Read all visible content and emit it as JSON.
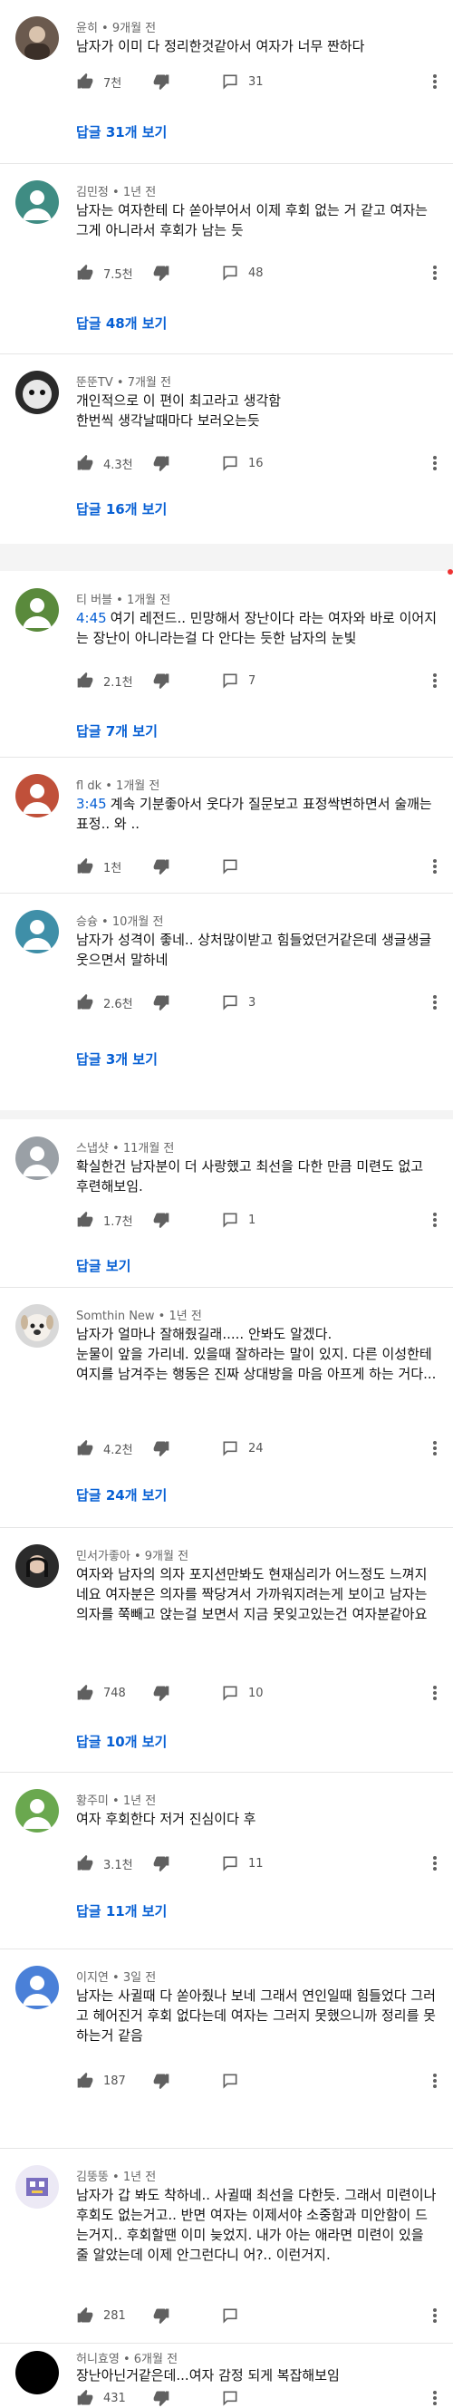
{
  "ui": {
    "accent": "#065fd4",
    "icons": {
      "like": "thumb-up-icon",
      "dislike": "thumb-down-icon",
      "reply": "reply-icon",
      "more": "more-vert-icon"
    }
  },
  "comments": [
    {
      "author": "윤히",
      "time": "9개월 전",
      "text": "남자가 이미 다 정리한것같아서 여자가 너무 짠하다",
      "likes": "7천",
      "reply_count": "31",
      "replies": "답글 31개 보기"
    },
    {
      "author": "김민정",
      "time": "1년 전",
      "text": "남자는 여자한테 다 쏟아부어서 이제 후회 없는 거 같고 여자는 그게 아니라서 후회가 남는 듯",
      "likes": "7.5천",
      "reply_count": "48",
      "replies": "답글 48개 보기"
    },
    {
      "author": "뚠뚠TV",
      "time": "7개월 전",
      "text": "개인적으로 이 편이 최고라고 생각함\n한번씩 생각날때마다 보러오는듯",
      "likes": "4.3천",
      "reply_count": "16",
      "replies": "답글 16개 보기"
    },
    {
      "author": "티 버블",
      "time": "1개월 전",
      "timestamp": "4:45",
      "text": "여기 레전드.. 민망해서 장난이다 라는 여자와  바로 이어지는 장난이 아니라는걸 다 안다는 듯한 남자의 눈빛",
      "likes": "2.1천",
      "reply_count": "7",
      "replies": "답글 7개 보기"
    },
    {
      "author": "fl dk",
      "time": "1개월 전",
      "timestamp": "3:45",
      "text": "계속 기분좋아서 웃다가 질문보고 표정싹변하면서 술깨는 표정.. 와 ..",
      "likes": "1천",
      "reply_count": ""
    },
    {
      "author": "승슝",
      "time": "10개월 전",
      "text": "남자가 성격이 좋네.. 상처많이받고 힘들었던거같은데 생글생글웃으면서 말하네",
      "likes": "2.6천",
      "reply_count": "3",
      "replies": "답글 3개 보기"
    },
    {
      "author": "스냅샷",
      "time": "11개월 전",
      "text": "확실한건 남자분이 더 사랑했고 최선을 다한 만큼 미련도 없고 후련해보임.",
      "likes": "1.7천",
      "reply_count": "1",
      "replies": "답글 보기"
    },
    {
      "author": "Somthin New",
      "time": "1년 전",
      "text": "남자가 얼마나 잘해줬길래..... 안봐도 알겠다.\n눈물이 앞을 가리네. 있을때 잘하라는 말이 있지. 다른 이성한테 여지를 남겨주는 행동은 진짜 상대방을 마음 아프게 하는 거다...",
      "likes": "4.2천",
      "reply_count": "24",
      "replies": "답글 24개 보기"
    },
    {
      "author": "민서가좋아",
      "time": "9개월 전",
      "text": "여자와 남자의 의자 포지션만봐도  현재심리가 어느정도 느껴지네요 여자분은 의자를 짝당겨서 가까워지려는게 보이고 남자는 의자를 쭉빼고 앉는걸 보면서 지금 못잊고있는건 여자분같아요",
      "likes": "748",
      "reply_count": "10",
      "replies": "답글 10개 보기"
    },
    {
      "author": "황주미",
      "time": "1년 전",
      "text": "여자 후회한다 저거 진심이다 후",
      "likes": "3.1천",
      "reply_count": "11",
      "replies": "답글 11개 보기"
    },
    {
      "author": "이지연",
      "time": "3일 전",
      "text": "남자는 사귈때 다 쏟아줬나 보네 그래서 연인일때 힘들었다 그러고 헤어진거 후회 없다는데 여자는 그러지 못했으니까 정리를 못 하는거 같음",
      "likes": "187",
      "reply_count": ""
    },
    {
      "author": "김뚱뚱",
      "time": "1년 전",
      "text": "남자가 갑 봐도 착하네.. 사귈때 최선을 다한듯. 그래서 미련이나 후회도 없는거고.. 반면 여자는 이제서야 소중함과 미안함이 드는거지.. 후회할땐 이미 늦었지. 내가 아는 애라면 미련이 있을 줄 알았는데 이제 안그런다니 어?.. 이런거지.",
      "likes": "281",
      "reply_count": ""
    },
    {
      "author": "허니효영",
      "time": "6개월 전",
      "text": "장난아닌거같은데...여자 감정 되게 복잡해보임",
      "likes": "431",
      "reply_count": ""
    }
  ]
}
